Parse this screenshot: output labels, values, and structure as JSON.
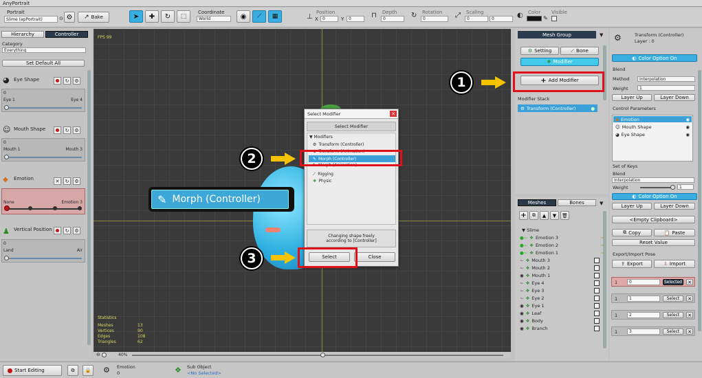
{
  "app_title": "AnyPortrait",
  "toolbar": {
    "portrait_label": "Portrait",
    "portrait_value": "Slime (apPortrait)",
    "bake_label": "Bake",
    "coordinate_label": "Coordinate",
    "coordinate_value": "World",
    "position_label": "Position",
    "x_label": "X",
    "x_value": "0",
    "y_label": "Y",
    "y_value": "0",
    "depth_label": "Depth",
    "depth_value": "0",
    "rotation_label": "Rotation",
    "rotation_value": "0",
    "scaling_label": "Scaling",
    "scaling_x": "0",
    "scaling_y": "0",
    "color_label": "Color",
    "visible_label": "Visible"
  },
  "left_panel": {
    "tab_hierarchy": "Hierarchy",
    "tab_controller": "Controller",
    "category_label": "Category",
    "category_value": "Everything",
    "set_default_all": "Set Default All",
    "params": [
      {
        "name": "Eye Shape",
        "value": "0",
        "min_label": "Eye 1",
        "max_label": "Eye 4"
      },
      {
        "name": "Mouth Shape",
        "value": "0",
        "min_label": "Mouth 1",
        "max_label": "Mouth 3"
      },
      {
        "name": "Emotion",
        "value": "",
        "min_label": "None",
        "max_label": "Emotion 3"
      },
      {
        "name": "Vertical Position",
        "value": "0",
        "min_label": "Land",
        "max_label": "Air"
      }
    ]
  },
  "viewport": {
    "fps": "FPS 99",
    "zoom": "40%",
    "statistics_title": "Statistics",
    "stats": [
      {
        "label": "Meshes",
        "value": "13"
      },
      {
        "label": "Vertices",
        "value": "90"
      },
      {
        "label": "Edges",
        "value": "108"
      },
      {
        "label": "Triangles",
        "value": "62"
      }
    ],
    "morph_callout_label": "Morph (Controller)"
  },
  "dialog": {
    "title": "Select Modifier",
    "header": "Select Modifier",
    "group_label": "Modifiers",
    "items": [
      "Transform (Controller)",
      "Transform (Animation)",
      "Morph (Controller)",
      "Morph (Animation)",
      "Rigging",
      "Physic"
    ],
    "description": "Changing shape freely\naccording to [Controller]",
    "select_button": "Select",
    "close_button": "Close"
  },
  "annotations": [
    "1",
    "2",
    "3"
  ],
  "mesh_group_panel": {
    "title": "Mesh Group",
    "setting_label": "Setting",
    "bone_label": "Bone",
    "modifier_label": "Modifier",
    "add_modifier_label": "Add Modifier",
    "modifier_stack_label": "Modifier Stack",
    "stack_items": [
      "Transform (Controller)"
    ]
  },
  "meshes_panel": {
    "tab_meshes": "Meshes",
    "tab_bones": "Bones",
    "root": "Slime",
    "items": [
      "Emotion 3",
      "Emotion 2",
      "Emotion 1",
      "Mouth 3",
      "Mouth 2",
      "Mouth 1",
      "Eye 4",
      "Eye 3",
      "Eye 2",
      "Eye 1",
      "Leaf",
      "Body",
      "Branch"
    ]
  },
  "inspector": {
    "title": "Transform (Controller)",
    "layer": "Layer : 0",
    "color_option": "Color Option On",
    "blend_label": "Blend",
    "method_label": "Method",
    "method_value": "Interpolation",
    "weight_label": "Weight",
    "weight_value": "1",
    "layer_up": "Layer Up",
    "layer_down": "Layer Down",
    "control_params_label": "Control Parameters",
    "control_params": [
      "Emotion",
      "Mouth Shape",
      "Eye Shape"
    ],
    "set_of_keys_label": "Set of Keys",
    "blend2_label": "Blend",
    "blend2_value": "Interpolation",
    "weight2_label": "Weight",
    "weight2_value": "1",
    "color_option2": "Color Option On",
    "layer_up2": "Layer Up",
    "layer_down2": "Layer Down",
    "clipboard": "<Empty Clipboard>",
    "copy_label": "Copy",
    "paste_label": "Paste",
    "reset_value": "Reset Value",
    "export_import_label": "Export/Import Pose",
    "export_label": "Export",
    "import_label": "Import",
    "keys": [
      {
        "index": "1",
        "value": "0",
        "button": "Selected"
      },
      {
        "index": "1",
        "value": "1",
        "button": "Select"
      },
      {
        "index": "1",
        "value": "2",
        "button": "Select"
      },
      {
        "index": "1",
        "value": "3",
        "button": "Select"
      }
    ]
  },
  "status_bar": {
    "start_editing": "Start Editing",
    "emotion_label": "Emotion",
    "emotion_value": "0",
    "sub_object_label": "Sub Object",
    "sub_object_value": "<No Selected>"
  },
  "colors": {
    "accent": "#3aaee0",
    "header": "#2b3b50",
    "annotation_red": "#e0101a",
    "arrow_yellow": "#f7c300"
  }
}
